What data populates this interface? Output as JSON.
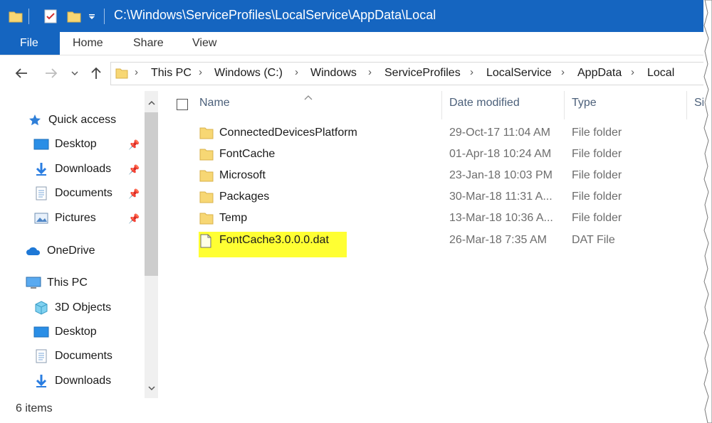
{
  "window": {
    "title_path": "C:\\Windows\\ServiceProfiles\\LocalService\\AppData\\Local",
    "accent_color": "#1565c0",
    "quick_access_icons": [
      "folder-icon",
      "properties-icon",
      "new-folder-icon",
      "customize-dropdown-icon"
    ]
  },
  "ribbon": {
    "tabs": [
      {
        "label": "File"
      },
      {
        "label": "Home"
      },
      {
        "label": "Share"
      },
      {
        "label": "View"
      }
    ]
  },
  "address": {
    "breadcrumbs": [
      "This PC",
      "Windows (C:)",
      "Windows",
      "ServiceProfiles",
      "LocalService",
      "AppData",
      "Local"
    ],
    "nav_icons": [
      "back-arrow-icon",
      "forward-arrow-icon",
      "recent-dropdown-icon",
      "up-arrow-icon"
    ]
  },
  "nav_pane": {
    "items": [
      {
        "label": "Quick access",
        "icon": "star-icon",
        "pinned": false
      },
      {
        "label": "Desktop",
        "icon": "desktop-icon",
        "pinned": true
      },
      {
        "label": "Downloads",
        "icon": "download-icon",
        "pinned": true
      },
      {
        "label": "Documents",
        "icon": "documents-icon",
        "pinned": true
      },
      {
        "label": "Pictures",
        "icon": "pictures-icon",
        "pinned": true
      },
      {
        "label": "OneDrive",
        "icon": "cloud-icon",
        "pinned": false
      },
      {
        "label": "This PC",
        "icon": "computer-icon",
        "pinned": false
      },
      {
        "label": "3D Objects",
        "icon": "cube-icon",
        "pinned": false
      },
      {
        "label": "Desktop",
        "icon": "desktop-icon",
        "pinned": false
      },
      {
        "label": "Documents",
        "icon": "documents-icon",
        "pinned": false
      },
      {
        "label": "Downloads",
        "icon": "download-icon",
        "pinned": false
      }
    ]
  },
  "file_list": {
    "columns": [
      {
        "label": "Name"
      },
      {
        "label": "Date modified"
      },
      {
        "label": "Type"
      },
      {
        "label": "Si"
      }
    ],
    "rows": [
      {
        "name": "ConnectedDevicesPlatform",
        "date": "29-Oct-17 11:04 AM",
        "type": "File folder",
        "icon": "folder-icon"
      },
      {
        "name": "FontCache",
        "date": "01-Apr-18 10:24 AM",
        "type": "File folder",
        "icon": "folder-icon"
      },
      {
        "name": "Microsoft",
        "date": "23-Jan-18 10:03 PM",
        "type": "File folder",
        "icon": "folder-icon"
      },
      {
        "name": "Packages",
        "date": "30-Mar-18 11:31 A...",
        "type": "File folder",
        "icon": "folder-icon"
      },
      {
        "name": "Temp",
        "date": "13-Mar-18 10:36 A...",
        "type": "File folder",
        "icon": "folder-icon"
      },
      {
        "name": "FontCache3.0.0.0.dat",
        "date": "26-Mar-18 7:35 AM",
        "type": "DAT File",
        "icon": "file-icon"
      }
    ],
    "highlight_color": "#ffff33"
  },
  "status": {
    "item_count": "6 items"
  }
}
